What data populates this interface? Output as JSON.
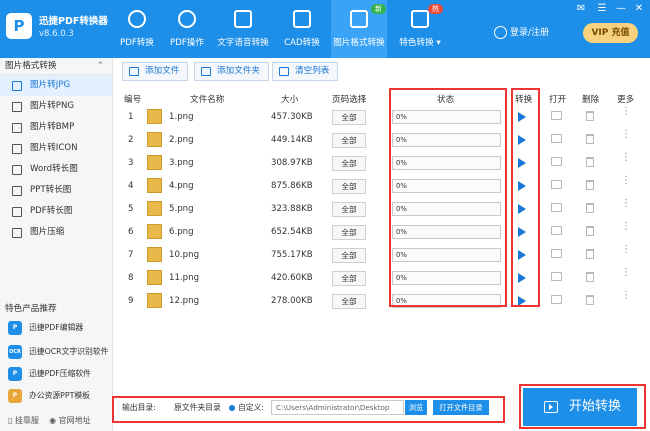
{
  "app": {
    "name": "迅捷PDF转换器",
    "version": "v8.6.0.3",
    "logo": "P"
  },
  "tabs": [
    {
      "label": "PDF转换",
      "badge": ""
    },
    {
      "label": "PDF操作",
      "badge": ""
    },
    {
      "label": "文字语音转换",
      "badge": ""
    },
    {
      "label": "CAD转换",
      "badge": ""
    },
    {
      "label": "图片格式转换",
      "badge": "新"
    },
    {
      "label": "特色转换 ▾",
      "badge": "热"
    }
  ],
  "header": {
    "login": "登录/注册",
    "vip": "VIP 充值"
  },
  "sidebar": {
    "section_title": "图片格式转换",
    "section_arrow": "⌃",
    "items": [
      "图片转JPG",
      "图片转PNG",
      "图片转BMP",
      "图片转ICON",
      "Word转长图",
      "PPT转长图",
      "PDF转长图",
      "图片压缩"
    ],
    "featured_title": "特色产品推荐",
    "products": [
      {
        "label": "迅捷PDF编辑器",
        "icon": "P",
        "color": "#1e8fe8"
      },
      {
        "label": "迅捷OCR文字识别软件",
        "icon": "OCR",
        "color": "#1e8fe8"
      },
      {
        "label": "迅捷PDF压缩软件",
        "icon": "P",
        "color": "#1e8fe8"
      },
      {
        "label": "办公资源PPT模板",
        "icon": "P",
        "color": "#e8a53a"
      }
    ],
    "footer_left": "挂靠服",
    "footer_right": "官网地址"
  },
  "toolbar": {
    "add_file": "添加文件",
    "add_folder": "添加文件夹",
    "clear": "清空列表"
  },
  "table": {
    "headers": {
      "no": "编号",
      "name": "文件名称",
      "size": "大小",
      "pages": "页码选择",
      "status": "状态",
      "convert": "转换",
      "open": "打开",
      "delete": "删除",
      "more": "更多"
    },
    "rows": [
      {
        "no": "1",
        "name": "1.png",
        "size": "457.30KB",
        "pages": "全部",
        "progress": "0%"
      },
      {
        "no": "2",
        "name": "2.png",
        "size": "449.14KB",
        "pages": "全部",
        "progress": "0%"
      },
      {
        "no": "3",
        "name": "3.png",
        "size": "308.97KB",
        "pages": "全部",
        "progress": "0%"
      },
      {
        "no": "4",
        "name": "4.png",
        "size": "875.86KB",
        "pages": "全部",
        "progress": "0%"
      },
      {
        "no": "5",
        "name": "5.png",
        "size": "323.88KB",
        "pages": "全部",
        "progress": "0%"
      },
      {
        "no": "6",
        "name": "6.png",
        "size": "652.54KB",
        "pages": "全部",
        "progress": "0%"
      },
      {
        "no": "7",
        "name": "10.png",
        "size": "755.17KB",
        "pages": "全部",
        "progress": "0%"
      },
      {
        "no": "8",
        "name": "11.png",
        "size": "420.60KB",
        "pages": "全部",
        "progress": "0%"
      },
      {
        "no": "9",
        "name": "12.png",
        "size": "278.00KB",
        "pages": "全部",
        "progress": "0%"
      }
    ]
  },
  "output": {
    "label": "输出目录:",
    "source_dir": "原文件夹目录",
    "custom": "自定义:",
    "path": "C:\\Users\\Administrator\\Desktop",
    "browse": "浏览",
    "open_folder": "打开文件目录"
  },
  "start_button": "开始转换",
  "colors": {
    "accent": "#1e8fe8",
    "highlight": "#e33333"
  }
}
